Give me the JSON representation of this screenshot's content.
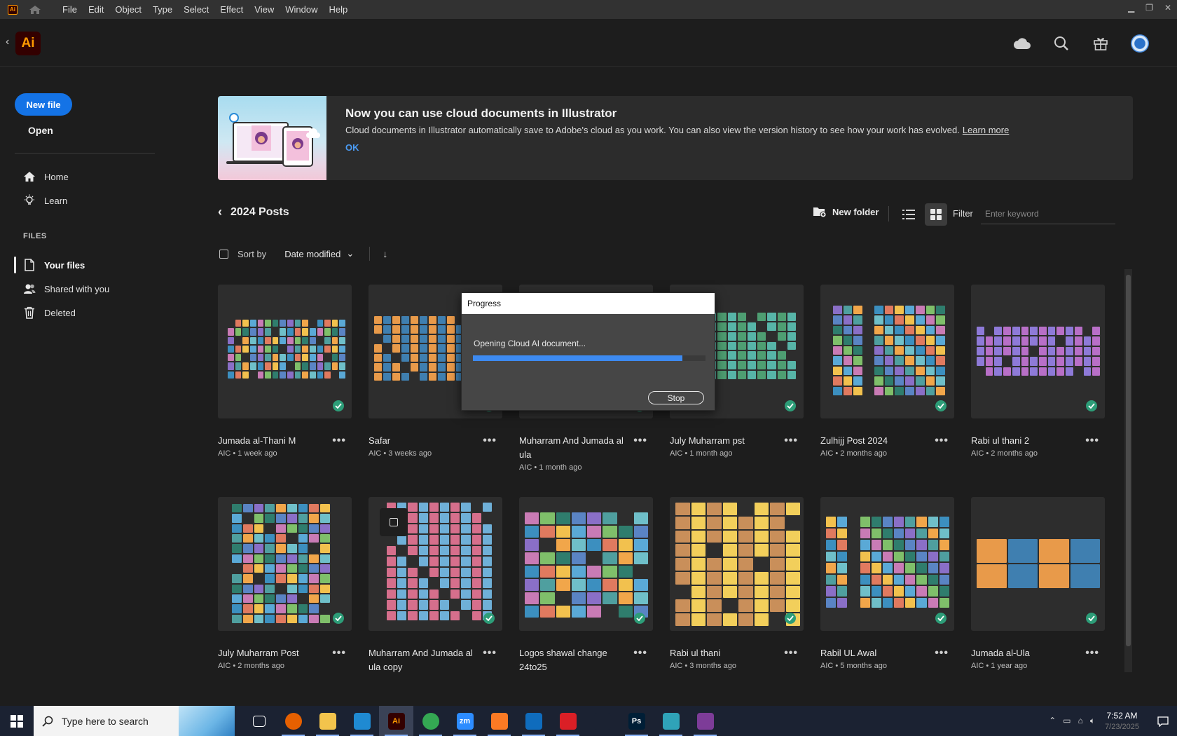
{
  "menubar": {
    "app_mini": "Ai",
    "items": [
      "File",
      "Edit",
      "Object",
      "Type",
      "Select",
      "Effect",
      "View",
      "Window",
      "Help"
    ]
  },
  "appbar": {
    "logo": "Ai"
  },
  "sidebar": {
    "new_file": "New file",
    "open": "Open",
    "home": "Home",
    "learn": "Learn",
    "section": "FILES",
    "your_files": "Your files",
    "shared": "Shared with you",
    "deleted": "Deleted"
  },
  "banner": {
    "title": "Now you can use cloud documents in Illustrator",
    "text": "Cloud documents in Illustrator automatically save to Adobe's cloud as you work. You can also view the version history to see how your work has evolved.",
    "learn_more": "Learn more",
    "ok": "OK"
  },
  "toolbar": {
    "folder": "2024 Posts",
    "new_folder": "New folder",
    "filter": "Filter",
    "filter_placeholder": "Enter keyword",
    "sort_by": "Sort by",
    "sort_value": "Date modified"
  },
  "files": [
    {
      "title": "Jumada al-Thani M",
      "meta": "AIC • 1 week ago"
    },
    {
      "title": "Safar",
      "meta": "AIC • 3 weeks ago"
    },
    {
      "title": "Muharram And Jumada al ula",
      "meta": "AIC • 1 month ago"
    },
    {
      "title": "July Muharram pst",
      "meta": "AIC • 1 month ago"
    },
    {
      "title": "Zulhijj Post 2024",
      "meta": "AIC • 2 months ago"
    },
    {
      "title": "Rabi ul thani 2",
      "meta": "AIC • 2 months ago"
    },
    {
      "title": "July Muharram Post",
      "meta": "AIC • 2 months ago"
    },
    {
      "title": "Muharram And Jumada al ula copy",
      "meta": ""
    },
    {
      "title": "Logos shawal change 24to25",
      "meta": ""
    },
    {
      "title": "Rabi ul thani",
      "meta": "AIC • 3 months ago"
    },
    {
      "title": "Rabil UL Awal",
      "meta": "AIC • 5 months ago"
    },
    {
      "title": "Jumada al-Ula",
      "meta": "AIC • 1 year ago"
    }
  ],
  "dialog": {
    "title": "Progress",
    "message": "Opening Cloud AI document...",
    "progress": 0.9,
    "stop": "Stop"
  },
  "taskbar": {
    "search_placeholder": "Type here to search",
    "time": "7:52 AM",
    "date": "7/23/2025",
    "apps": [
      {
        "name": "task-view",
        "label": "",
        "color": "#1b2232"
      },
      {
        "name": "firefox",
        "label": "",
        "color": "#e66000"
      },
      {
        "name": "file-explorer",
        "label": "",
        "color": "#f3c44c"
      },
      {
        "name": "vscode",
        "label": "",
        "color": "#1f8ad2"
      },
      {
        "name": "illustrator",
        "label": "Ai",
        "color": "#330000"
      },
      {
        "name": "chrome",
        "label": "",
        "color": "#34a853"
      },
      {
        "name": "zoom",
        "label": "zm",
        "color": "#2d8cff"
      },
      {
        "name": "xampp",
        "label": "",
        "color": "#fb7a24"
      },
      {
        "name": "outlook",
        "label": "",
        "color": "#0f6cbd"
      },
      {
        "name": "creative-cloud",
        "label": "",
        "color": "#da1f26"
      },
      {
        "name": "pen-tool",
        "label": "",
        "color": "#1b2232"
      },
      {
        "name": "photoshop",
        "label": "Ps",
        "color": "#001e36"
      },
      {
        "name": "app-diamond",
        "label": "",
        "color": "#2fa3b8"
      },
      {
        "name": "winrar",
        "label": "",
        "color": "#7d3c98"
      }
    ]
  },
  "colors": {
    "accent": "#1473e6",
    "check": "#2d9d78"
  }
}
